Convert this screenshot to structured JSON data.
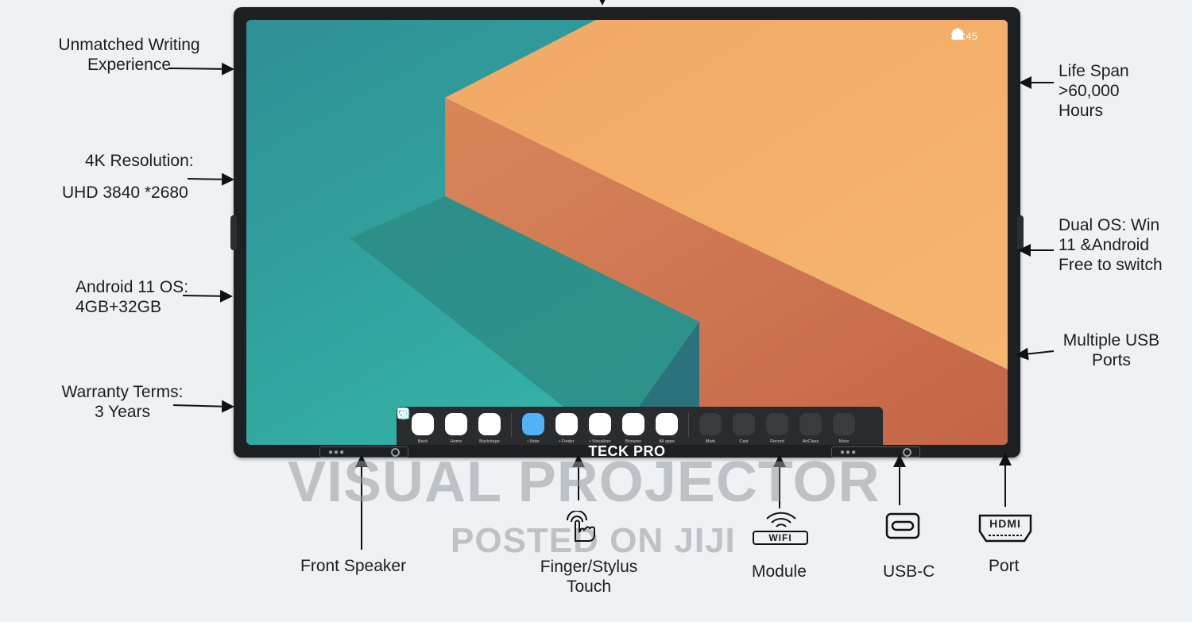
{
  "screen": {
    "status_time": "16:45",
    "status_icons": [
      "sliders-icon",
      "brightness-icon",
      "volume-icon",
      "camera-icon",
      "video-icon",
      "cast-icon",
      "sync-icon",
      "network-icon",
      "wifi-icon"
    ]
  },
  "dock": {
    "items": [
      {
        "label": "Back",
        "icon": "back-icon",
        "color": "#ffffff"
      },
      {
        "label": "Home",
        "icon": "home-icon",
        "color": "#ffffff"
      },
      {
        "label": "Backstage",
        "icon": "backstage-icon",
        "color": "#ffffff"
      },
      {
        "label": "• Note",
        "icon": "note-app-icon",
        "color": "#4fb3f6"
      },
      {
        "label": "• Finder",
        "icon": "finder-app-icon",
        "color": "#f7c23d"
      },
      {
        "label": "• Visualizer",
        "icon": "visualizer-app-icon",
        "color": "#f28b5e"
      },
      {
        "label": "Browser",
        "icon": "browser-app-icon",
        "color": "#2fbfa0"
      },
      {
        "label": "All apps",
        "icon": "all-apps-icon",
        "color": "#5ab0f0"
      },
      {
        "label": "Mark",
        "icon": "mark-icon",
        "color": "#ffffff"
      },
      {
        "label": "Cast",
        "icon": "cast-icon",
        "color": "#ffffff"
      },
      {
        "label": "Record",
        "icon": "record-icon",
        "color": "#ffffff"
      },
      {
        "label": "AirClass",
        "icon": "airclass-icon",
        "color": "#ffffff"
      },
      {
        "label": "More",
        "icon": "more-icon",
        "color": "#ffffff"
      }
    ]
  },
  "brand": "TECK PRO",
  "labels": {
    "writing": "Unmatched Writing\nExperience",
    "resolution_title": "4K Resolution:",
    "resolution_value": "UHD 3840 *2680",
    "android": "Android 11 OS:\n4GB+32GB",
    "warranty": "Warranty Terms:\n3 Years",
    "lifespan": "Life Span\n>60,000\nHours",
    "dual_os": "Dual OS: Win\n11 &Android\nFree to switch",
    "usb_ports": "Multiple USB\nPorts",
    "front_speaker": "Front Speaker",
    "touch": "Finger/Stylus\nTouch",
    "module": "Module",
    "usb_c": "USB-C",
    "port": "Port"
  },
  "icon_text": {
    "wifi": "WIFI",
    "hdmi": "HDMI"
  },
  "watermark": {
    "main": "VISUAL PROJECTOR",
    "sub": "POSTED ON JIJI"
  }
}
